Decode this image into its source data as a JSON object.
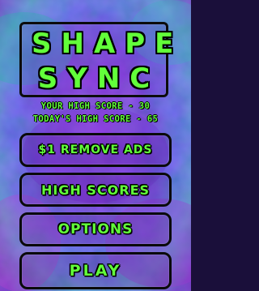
{
  "title": {
    "line1": "SHAPE",
    "line2": "SYNC"
  },
  "scores": {
    "your_high": "YOUR HIGH SCORE - 30",
    "todays_high": "TODAY'S HIGH SCORE - 65"
  },
  "menu": {
    "remove_ads": "$1 REMOVE ADS",
    "high_scores": "HIGH SCORES",
    "options": "OPTIONS",
    "play": "PLAY"
  },
  "colors": {
    "text_green": "#62ff3a",
    "outline": "#0a0a0a",
    "bg_purple": "#7a2bd0",
    "bg_blue": "#2a5ad8",
    "bg_teal": "#2fb3b0"
  }
}
